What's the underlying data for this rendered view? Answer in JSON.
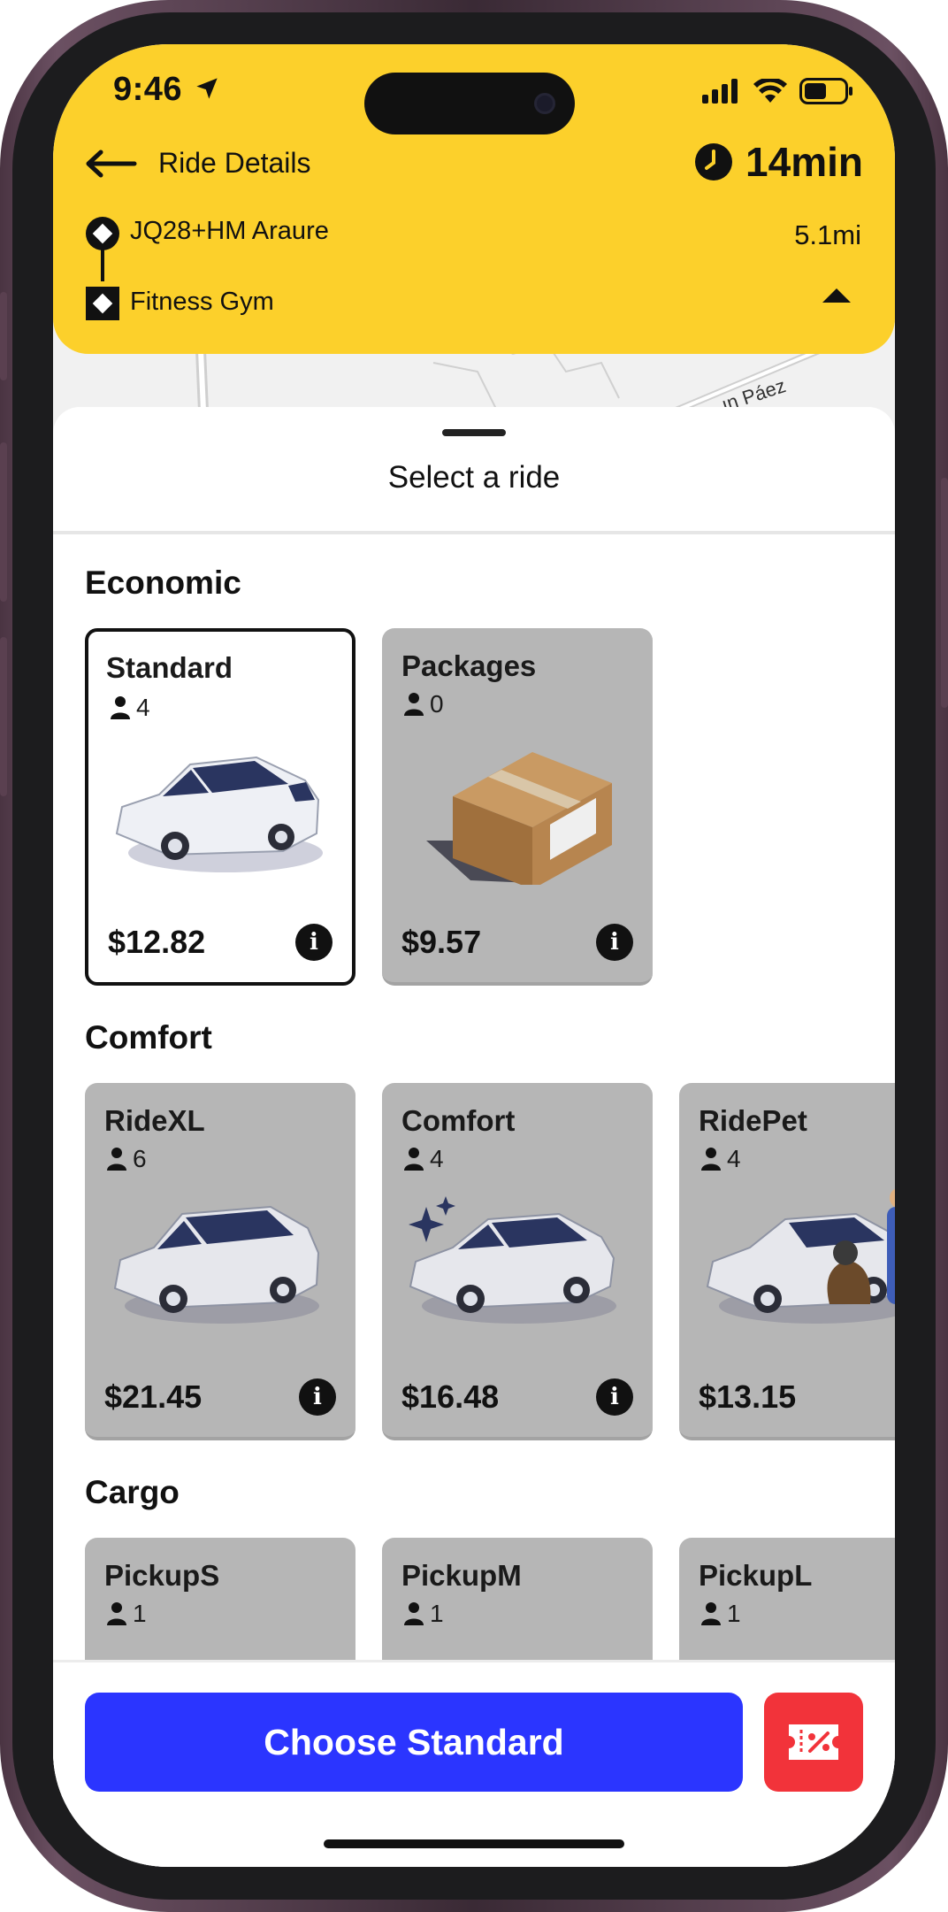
{
  "status_bar": {
    "time": "9:46"
  },
  "header": {
    "title": "Ride Details",
    "eta": "14min",
    "origin": "JQ28+HM Araure",
    "destination": "Fitness Gym",
    "distance": "5.1mi",
    "background_color": "#FCD02B"
  },
  "map": {
    "street_label": "ın Páez"
  },
  "sheet": {
    "title": "Select a ride",
    "sections": [
      {
        "title": "Economic",
        "options": [
          {
            "name": "Standard",
            "seats": "4",
            "price": "$12.82",
            "image": "sedan-car-icon",
            "selected": true
          },
          {
            "name": "Packages",
            "seats": "0",
            "price": "$9.57",
            "image": "package-box-icon",
            "selected": false
          }
        ]
      },
      {
        "title": "Comfort",
        "options": [
          {
            "name": "RideXL",
            "seats": "6",
            "price": "$21.45",
            "image": "minivan-icon"
          },
          {
            "name": "Comfort",
            "seats": "4",
            "price": "$16.48",
            "image": "sparkle-car-icon"
          },
          {
            "name": "RidePet",
            "seats": "4",
            "price": "$13.15",
            "image": "pet-car-icon"
          }
        ]
      },
      {
        "title": "Cargo",
        "options": [
          {
            "name": "PickupS",
            "seats": "1"
          },
          {
            "name": "PickupM",
            "seats": "1"
          },
          {
            "name": "PickupL",
            "seats": "1"
          }
        ]
      }
    ]
  },
  "bottom": {
    "choose_label": "Choose Standard",
    "choose_color": "#2B35FF",
    "promo_icon": "discount-ticket-icon",
    "promo_color": "#F2333A"
  }
}
